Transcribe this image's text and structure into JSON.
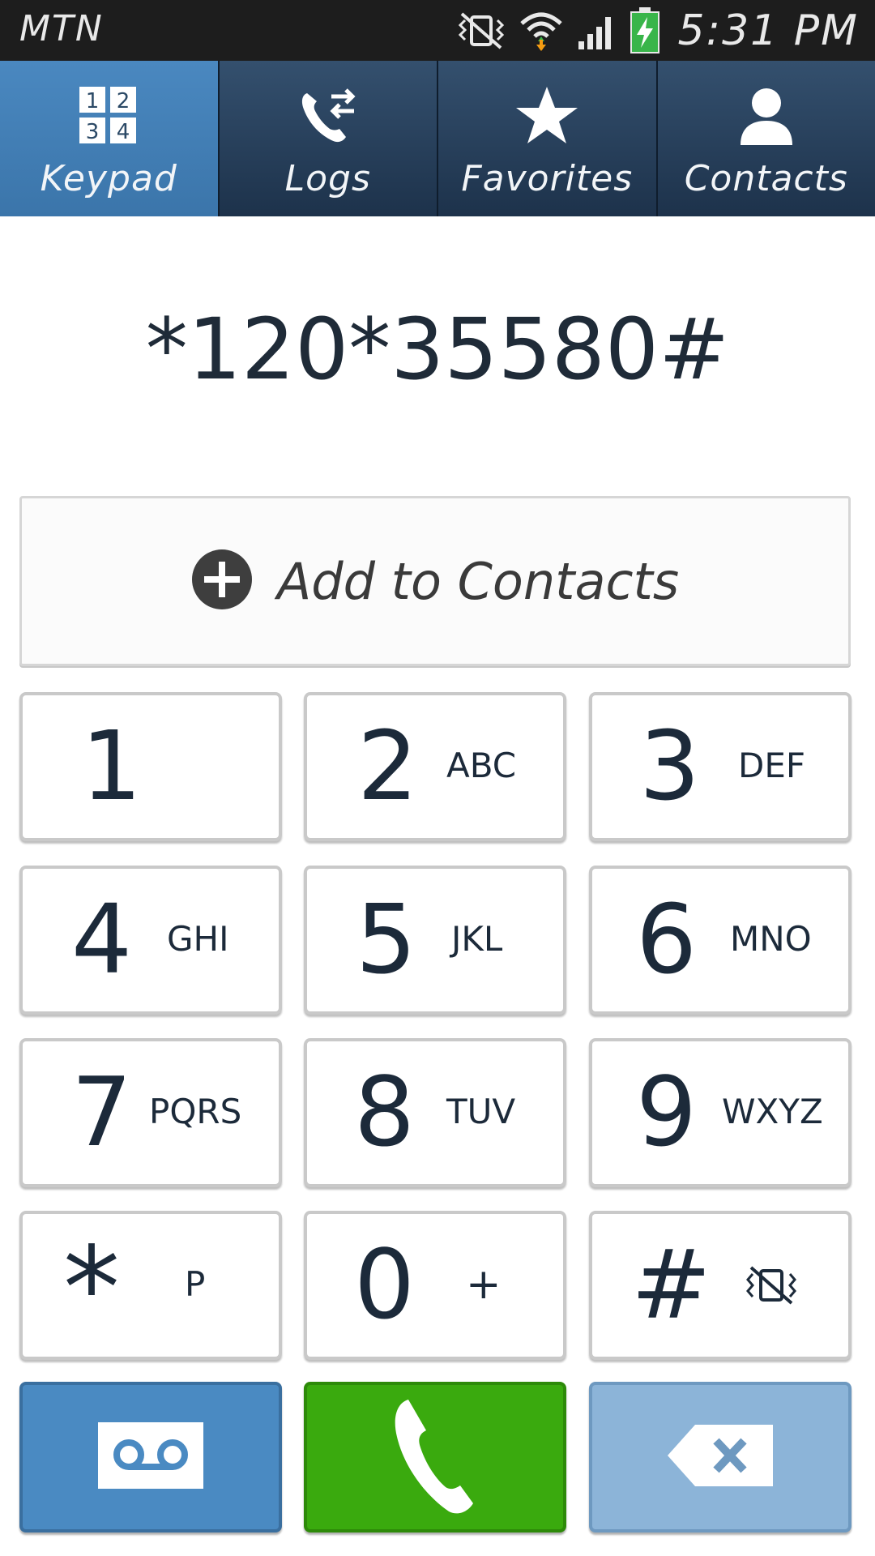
{
  "status_bar": {
    "carrier": "MTN",
    "time": "5:31 PM",
    "icons": [
      "vibrate-mute-icon",
      "wifi-icon",
      "signal-icon",
      "battery-charging-icon"
    ]
  },
  "tabs": [
    {
      "label": "Keypad",
      "icon": "keypad-icon",
      "active": true
    },
    {
      "label": "Logs",
      "icon": "logs-icon",
      "active": false
    },
    {
      "label": "Favorites",
      "icon": "star-icon",
      "active": false
    },
    {
      "label": "Contacts",
      "icon": "person-icon",
      "active": false
    }
  ],
  "dialer": {
    "number": "*120*35580#",
    "add_to_contacts": "Add to Contacts"
  },
  "keys": [
    {
      "digit": "1",
      "letters": ""
    },
    {
      "digit": "2",
      "letters": "ABC"
    },
    {
      "digit": "3",
      "letters": "DEF"
    },
    {
      "digit": "4",
      "letters": "GHI"
    },
    {
      "digit": "5",
      "letters": "JKL"
    },
    {
      "digit": "6",
      "letters": "MNO"
    },
    {
      "digit": "7",
      "letters": "PQRS"
    },
    {
      "digit": "8",
      "letters": "TUV"
    },
    {
      "digit": "9",
      "letters": "WXYZ"
    },
    {
      "digit": "*",
      "letters": "P"
    },
    {
      "digit": "0",
      "letters": "+"
    },
    {
      "digit": "#",
      "letters": ""
    }
  ],
  "actions": {
    "voicemail_icon": "voicemail-icon",
    "call_icon": "phone-icon",
    "backspace_icon": "backspace-icon"
  },
  "colors": {
    "active_tab": "#4a88c0",
    "tab_bar": "#1d324b",
    "call_green": "#3aaa0e",
    "voicemail_blue": "#4a8ac2",
    "backspace_blue": "#8cb4d8"
  }
}
